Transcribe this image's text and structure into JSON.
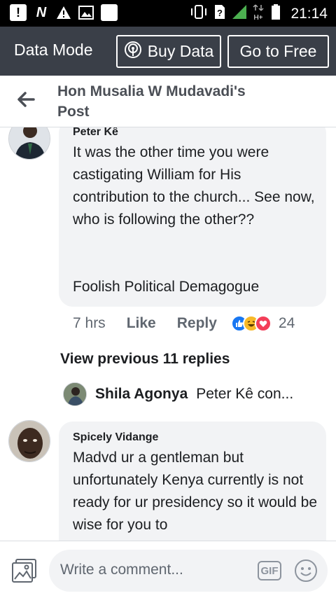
{
  "status_bar": {
    "time": "21:14",
    "left_icons": [
      "alert-icon",
      "network-n-icon",
      "warning-icon",
      "gallery-icon",
      "blank-square-icon"
    ],
    "right_icons": [
      "vibrate-icon",
      "unknown-sim-icon",
      "signal-icon",
      "hplus-icon",
      "battery-icon"
    ]
  },
  "data_bar": {
    "mode_label": "Data Mode",
    "buy_label": "Buy Data",
    "free_label": "Go to Free"
  },
  "header": {
    "title": "Hon Musalia W Mudavadi's Post"
  },
  "comments": [
    {
      "author": "Peter Kê",
      "text": "It was the other time you were castigating William for His contribution to the church... See now, who is following the other??",
      "text2": "Foolish Political Demagogue",
      "time": "7 hrs",
      "like": "Like",
      "reply": "Reply",
      "reaction_count": "24",
      "reactions": [
        "like",
        "haha",
        "love"
      ]
    },
    {
      "author": "Spicely Vidange",
      "text": "Madvd ur a gentleman but unfortunately Kenya currently is not ready for ur presidency so it would be wise for you to"
    }
  ],
  "replies": {
    "view_previous": "View previous 11 replies",
    "preview_author": "Shila Agonya",
    "preview_text": "Peter Kê con..."
  },
  "composer": {
    "placeholder": "Write a comment...",
    "gif_label": "GIF"
  },
  "colors": {
    "data_bar": "#3a3f48",
    "bubble": "#f2f3f5",
    "like_blue": "#1877f2",
    "haha_yellow": "#f7b928",
    "love_red": "#f33e58"
  }
}
